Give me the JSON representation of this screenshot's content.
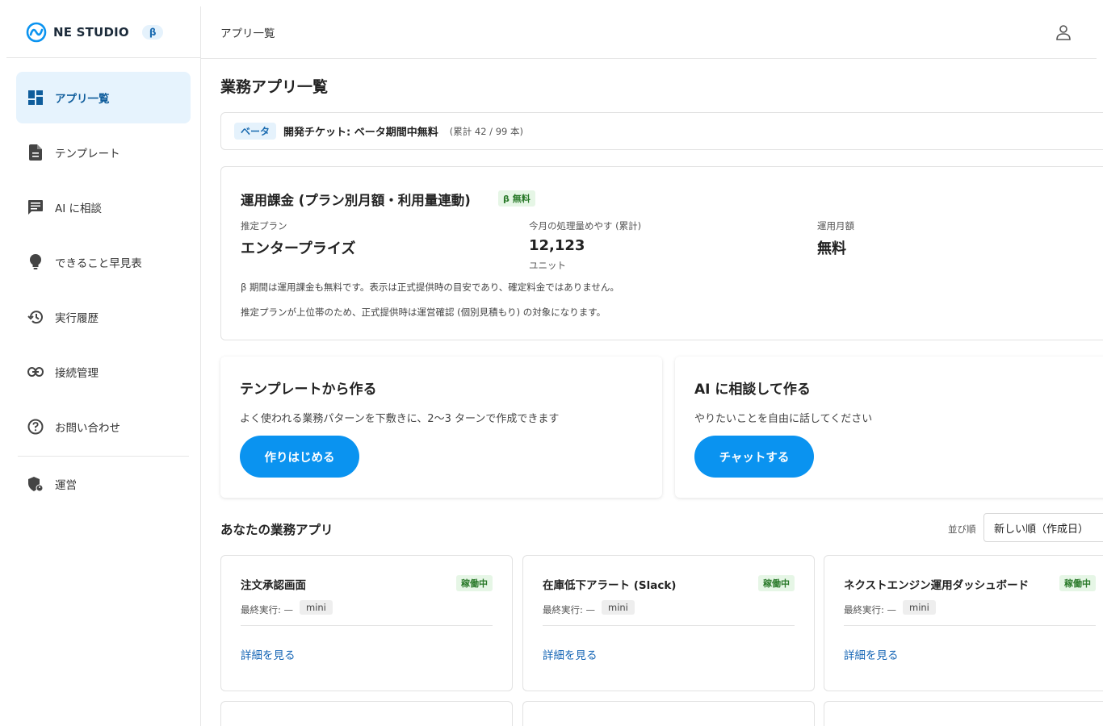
{
  "brand": {
    "name": "NE STUDIO",
    "beta": "β"
  },
  "sidebar": {
    "items": [
      {
        "label": "アプリ一覧",
        "icon": "dashboard-icon",
        "active": true
      },
      {
        "label": "テンプレート",
        "icon": "document-icon"
      },
      {
        "label": "AI に相談",
        "icon": "chat-icon"
      },
      {
        "label": "できること早見表",
        "icon": "lightbulb-icon"
      },
      {
        "label": "実行履歴",
        "icon": "history-icon"
      },
      {
        "label": "接続管理",
        "icon": "link-icon"
      },
      {
        "label": "お問い合わせ",
        "icon": "help-icon"
      },
      {
        "label": "運営",
        "icon": "admin-shield-icon"
      }
    ]
  },
  "header": {
    "title": "アプリ一覧"
  },
  "main": {
    "title": "業務アプリ一覧",
    "beta_bar": {
      "tag": "ベータ",
      "text": "開発チケット: ベータ期間中無料",
      "count": "(累計 42 / 99 本)"
    },
    "billing": {
      "title": "運用課金 (プラン別月額・利用量連動)",
      "tag": "β 無料",
      "plan_label": "推定プラン",
      "plan_value": "エンタープライズ",
      "usage_label": "今月の処理量めやす (累計)",
      "usage_value": "12,123",
      "usage_unit": "ユニット",
      "monthly_label": "運用月額",
      "monthly_value": "無料",
      "note1": "β 期間は運用課金も無料です。表示は正式提供時の目安であり、確定料金ではありません。",
      "note2": "推定プランが上位帯のため、正式提供時は運営確認 (個別見積もり) の対象になります。"
    },
    "cta_template": {
      "title": "テンプレートから作る",
      "subtitle": "よく使われる業務パターンを下敷きに、2〜3 ターンで作成できます",
      "button": "作りはじめる"
    },
    "cta_ai": {
      "title": "AI に相談して作る",
      "subtitle": "やりたいことを自由に話してください",
      "button": "チャットする"
    },
    "apps": {
      "title": "あなたの業務アプリ",
      "sort_label": "並び順",
      "sort_value": "新しい順（作成日）",
      "cards": [
        {
          "name": "注文承認画面",
          "status": "稼働中",
          "last_run": "最終実行: —",
          "tag": "mini",
          "link": "詳細を見る"
        },
        {
          "name": "在庫低下アラート (Slack)",
          "status": "稼働中",
          "last_run": "最終実行: —",
          "tag": "mini",
          "link": "詳細を見る"
        },
        {
          "name": "ネクストエンジン運用ダッシュボード",
          "status": "稼働中",
          "last_run": "最終実行: —",
          "tag": "mini",
          "link": "詳細を見る"
        }
      ]
    }
  },
  "colors": {
    "accent": "#0a93f0",
    "active_bg": "#e6f3fd",
    "status_green": "#2a7a2a"
  }
}
